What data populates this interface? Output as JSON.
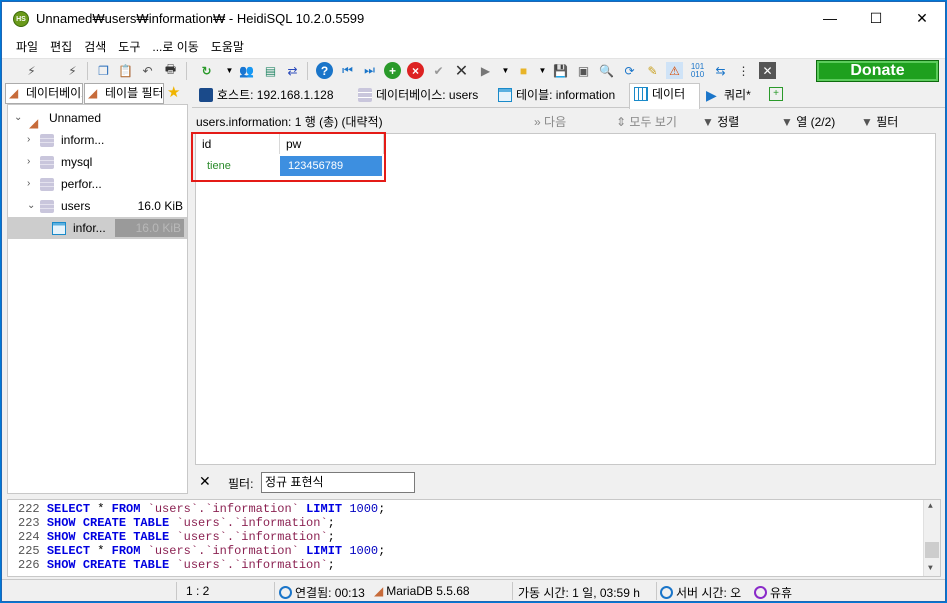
{
  "window": {
    "title": "Unnamed₩users₩information₩ - HeidiSQL 10.2.0.5599",
    "app_icon_text": "HS",
    "minimize": "—",
    "maximize": "☐",
    "close": "✕"
  },
  "menu": [
    "파일",
    "편집",
    "검색",
    "도구",
    "...로 이동",
    "도움말"
  ],
  "toolbar": {
    "donate_label": "Donate"
  },
  "left_tabs": {
    "database_filter": "데이터베이스",
    "table_filter": "테이블 필터"
  },
  "tree": {
    "root": "Unnamed",
    "items": [
      {
        "label": "inform...",
        "size": ""
      },
      {
        "label": "mysql",
        "size": ""
      },
      {
        "label": "perfor...",
        "size": ""
      },
      {
        "label": "users",
        "size": "16.0 KiB"
      }
    ],
    "child": {
      "label": "infor...",
      "size": "16.0 KiB"
    }
  },
  "tabs": {
    "host": "호스트: 192.168.1.128",
    "database": "데이터베이스: users",
    "table": "테이블: information",
    "data": "데이터",
    "query": "쿼리*"
  },
  "data_bar": {
    "info": "users.information: 1 행 (총) (대략적)",
    "next": "다음",
    "show_all": "모두 보기",
    "sort": "정렬",
    "columns": "열 (2/2)",
    "filter": "필터"
  },
  "grid": {
    "columns": [
      "id",
      "pw"
    ],
    "rows": [
      [
        "tiene",
        "123456789"
      ]
    ]
  },
  "filter": {
    "close": "✕",
    "label": "필터:",
    "placeholder": "정규 표현식"
  },
  "log": [
    {
      "n": "222",
      "parts": [
        [
          "kw",
          "SELECT"
        ],
        [
          "sym",
          " * "
        ],
        [
          "kw",
          "FROM"
        ],
        [
          "sym",
          " "
        ],
        [
          "str",
          "`users`.`information`"
        ],
        [
          "sym",
          " "
        ],
        [
          "kw",
          "LIMIT"
        ],
        [
          "sym",
          " "
        ],
        [
          "num",
          "1000"
        ],
        [
          "sym",
          ";"
        ]
      ]
    },
    {
      "n": "223",
      "parts": [
        [
          "kw",
          "SHOW CREATE TABLE"
        ],
        [
          "sym",
          " "
        ],
        [
          "str",
          "`users`.`information`"
        ],
        [
          "sym",
          ";"
        ]
      ]
    },
    {
      "n": "224",
      "parts": [
        [
          "kw",
          "SHOW CREATE TABLE"
        ],
        [
          "sym",
          " "
        ],
        [
          "str",
          "`users`.`information`"
        ],
        [
          "sym",
          ";"
        ]
      ]
    },
    {
      "n": "225",
      "parts": [
        [
          "kw",
          "SELECT"
        ],
        [
          "sym",
          " * "
        ],
        [
          "kw",
          "FROM"
        ],
        [
          "sym",
          " "
        ],
        [
          "str",
          "`users`.`information`"
        ],
        [
          "sym",
          " "
        ],
        [
          "kw",
          "LIMIT"
        ],
        [
          "sym",
          " "
        ],
        [
          "num",
          "1000"
        ],
        [
          "sym",
          ";"
        ]
      ]
    },
    {
      "n": "226",
      "parts": [
        [
          "kw",
          "SHOW CREATE TABLE"
        ],
        [
          "sym",
          " "
        ],
        [
          "str",
          "`users`.`information`"
        ],
        [
          "sym",
          ";"
        ]
      ]
    }
  ],
  "status": {
    "position": "1 : 2",
    "connected": "연결됨: 00:13",
    "server": "MariaDB 5.5.68",
    "uptime": "가동 시간: 1 일, 03:59 h",
    "server_time": "서버 시간: 오",
    "idle": "유휴"
  }
}
